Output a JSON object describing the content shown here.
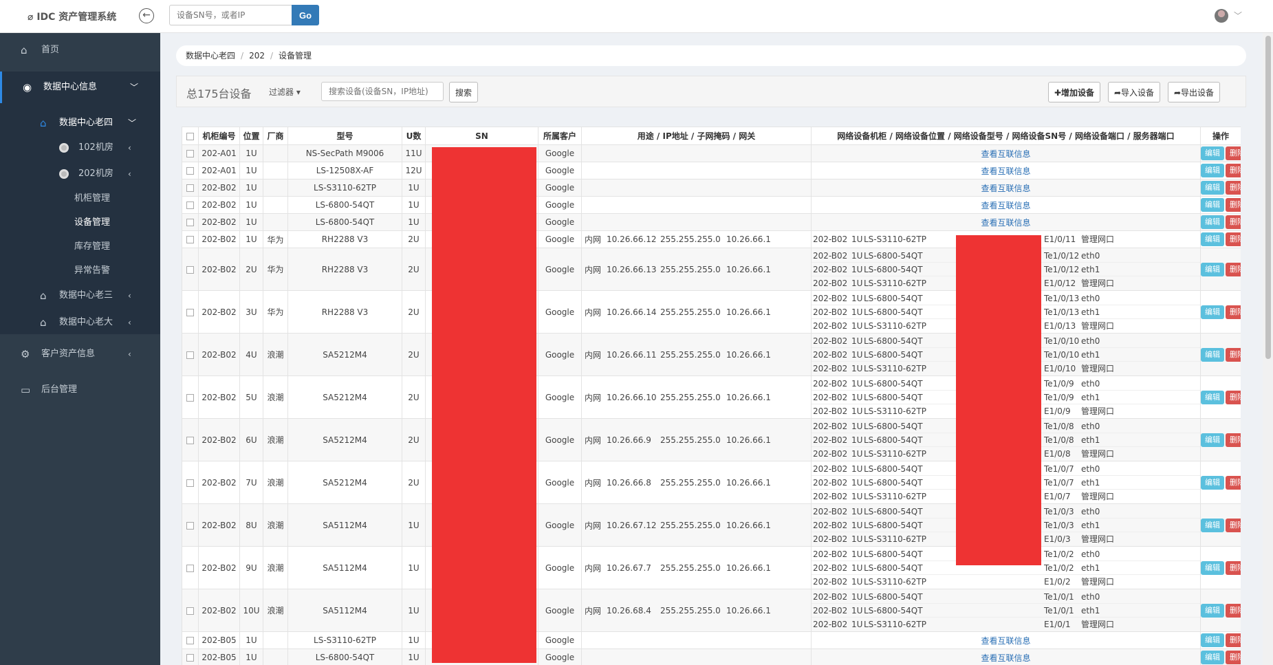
{
  "header": {
    "app_name": "IDC 资产管理系统",
    "logo_glyph": "⌀",
    "search_placeholder": "设备SN号，或者IP",
    "go_label": "Go"
  },
  "sidebar": {
    "home": "首页",
    "dc_info": "数据中心信息",
    "dc_old4": "数据中心老四",
    "room102": "102机房",
    "room202": "202机房",
    "cabinet_mgmt": "机柜管理",
    "device_mgmt": "设备管理",
    "stock_mgmt": "库存管理",
    "alarm": "异常告警",
    "dc_old3": "数据中心老三",
    "dc_big": "数据中心老大",
    "customer_assets": "客户资产信息",
    "backend": "后台管理"
  },
  "breadcrumb": [
    "数据中心老四",
    "202",
    "设备管理"
  ],
  "toolbar": {
    "total": "总175台设备",
    "filter": "过滤器",
    "search_placeholder": "搜索设备(设备SN，IP地址)",
    "search_btn": "搜索",
    "add_btn": "✚增加设备",
    "import_btn": "➦导入设备",
    "export_btn": "➦导出设备"
  },
  "table": {
    "headers": {
      "cabinet": "机柜编号",
      "pos": "位置",
      "vendor": "厂商",
      "model": "型号",
      "u": "U数",
      "sn": "SN",
      "customer": "所属客户",
      "ipinfo": "用途 / IP地址 / 子网掩码 / 网关",
      "netinfo": "网络设备机柜 / 网络设备位置 / 网络设备型号 / 网络设备SN号 / 网络设备端口 / 服务器端口",
      "ops": "操作"
    },
    "view_link": "查看互联信息",
    "edit_label": "编辑",
    "delete_label": "删除",
    "rows": [
      {
        "cab": "202-A01",
        "pos": "1U",
        "vendor": "",
        "model": "NS-SecPath M9006",
        "u": "11U",
        "cust": "Google",
        "type": "link"
      },
      {
        "cab": "202-A01",
        "pos": "1U",
        "vendor": "",
        "model": "LS-12508X-AF",
        "u": "12U",
        "cust": "Google",
        "type": "link"
      },
      {
        "cab": "202-B02",
        "pos": "1U",
        "vendor": "",
        "model": "LS-S3110-62TP",
        "u": "1U",
        "cust": "Google",
        "type": "link"
      },
      {
        "cab": "202-B02",
        "pos": "1U",
        "vendor": "",
        "model": "LS-6800-54QT",
        "u": "1U",
        "cust": "Google",
        "type": "link"
      },
      {
        "cab": "202-B02",
        "pos": "1U",
        "vendor": "",
        "model": "LS-6800-54QT",
        "u": "1U",
        "cust": "Google",
        "type": "link"
      },
      {
        "cab": "202-B02",
        "pos": "1U",
        "vendor": "华为",
        "model": "RH2288 V3",
        "u": "2U",
        "cust": "Google",
        "type": "net",
        "use": "内网",
        "ip": "10.26.66.12",
        "mask": "255.255.255.0",
        "gw": "10.26.66.1",
        "net": [
          {
            "cab": "202-B02",
            "pos": "1U",
            "model": "LS-S3110-62TP",
            "port": "E1/0/11",
            "sport": "管理网口"
          }
        ]
      },
      {
        "cab": "202-B02",
        "pos": "2U",
        "vendor": "华为",
        "model": "RH2288 V3",
        "u": "2U",
        "cust": "Google",
        "type": "net",
        "use": "内网",
        "ip": "10.26.66.13",
        "mask": "255.255.255.0",
        "gw": "10.26.66.1",
        "net": [
          {
            "cab": "202-B02",
            "pos": "1U",
            "model": "LS-6800-54QT",
            "port": "Te1/0/12",
            "sport": "eth0"
          },
          {
            "cab": "202-B02",
            "pos": "1U",
            "model": "LS-6800-54QT",
            "port": "Te1/0/12",
            "sport": "eth1"
          },
          {
            "cab": "202-B02",
            "pos": "1U",
            "model": "LS-S3110-62TP",
            "port": "E1/0/12",
            "sport": "管理网口"
          }
        ]
      },
      {
        "cab": "202-B02",
        "pos": "3U",
        "vendor": "华为",
        "model": "RH2288 V3",
        "u": "2U",
        "cust": "Google",
        "type": "net",
        "use": "内网",
        "ip": "10.26.66.14",
        "mask": "255.255.255.0",
        "gw": "10.26.66.1",
        "net": [
          {
            "cab": "202-B02",
            "pos": "1U",
            "model": "LS-6800-54QT",
            "port": "Te1/0/13",
            "sport": "eth0"
          },
          {
            "cab": "202-B02",
            "pos": "1U",
            "model": "LS-6800-54QT",
            "port": "Te1/0/13",
            "sport": "eth1"
          },
          {
            "cab": "202-B02",
            "pos": "1U",
            "model": "LS-S3110-62TP",
            "port": "E1/0/13",
            "sport": "管理网口"
          }
        ]
      },
      {
        "cab": "202-B02",
        "pos": "4U",
        "vendor": "浪潮",
        "model": "SA5212M4",
        "u": "2U",
        "cust": "Google",
        "type": "net",
        "use": "内网",
        "ip": "10.26.66.11",
        "mask": "255.255.255.0",
        "gw": "10.26.66.1",
        "net": [
          {
            "cab": "202-B02",
            "pos": "1U",
            "model": "LS-6800-54QT",
            "port": "Te1/0/10",
            "sport": "eth0"
          },
          {
            "cab": "202-B02",
            "pos": "1U",
            "model": "LS-6800-54QT",
            "port": "Te1/0/10",
            "sport": "eth1"
          },
          {
            "cab": "202-B02",
            "pos": "1U",
            "model": "LS-S3110-62TP",
            "port": "E1/0/10",
            "sport": "管理网口"
          }
        ]
      },
      {
        "cab": "202-B02",
        "pos": "5U",
        "vendor": "浪潮",
        "model": "SA5212M4",
        "u": "2U",
        "cust": "Google",
        "type": "net",
        "use": "内网",
        "ip": "10.26.66.10",
        "mask": "255.255.255.0",
        "gw": "10.26.66.1",
        "net": [
          {
            "cab": "202-B02",
            "pos": "1U",
            "model": "LS-6800-54QT",
            "port": "Te1/0/9",
            "sport": "eth0"
          },
          {
            "cab": "202-B02",
            "pos": "1U",
            "model": "LS-6800-54QT",
            "port": "Te1/0/9",
            "sport": "eth1"
          },
          {
            "cab": "202-B02",
            "pos": "1U",
            "model": "LS-S3110-62TP",
            "port": "E1/0/9",
            "sport": "管理网口"
          }
        ]
      },
      {
        "cab": "202-B02",
        "pos": "6U",
        "vendor": "浪潮",
        "model": "SA5212M4",
        "u": "2U",
        "cust": "Google",
        "type": "net",
        "use": "内网",
        "ip": "10.26.66.9",
        "mask": "255.255.255.0",
        "gw": "10.26.66.1",
        "net": [
          {
            "cab": "202-B02",
            "pos": "1U",
            "model": "LS-6800-54QT",
            "port": "Te1/0/8",
            "sport": "eth0"
          },
          {
            "cab": "202-B02",
            "pos": "1U",
            "model": "LS-6800-54QT",
            "port": "Te1/0/8",
            "sport": "eth1"
          },
          {
            "cab": "202-B02",
            "pos": "1U",
            "model": "LS-S3110-62TP",
            "port": "E1/0/8",
            "sport": "管理网口"
          }
        ]
      },
      {
        "cab": "202-B02",
        "pos": "7U",
        "vendor": "浪潮",
        "model": "SA5212M4",
        "u": "2U",
        "cust": "Google",
        "type": "net",
        "use": "内网",
        "ip": "10.26.66.8",
        "mask": "255.255.255.0",
        "gw": "10.26.66.1",
        "net": [
          {
            "cab": "202-B02",
            "pos": "1U",
            "model": "LS-6800-54QT",
            "port": "Te1/0/7",
            "sport": "eth0"
          },
          {
            "cab": "202-B02",
            "pos": "1U",
            "model": "LS-6800-54QT",
            "port": "Te1/0/7",
            "sport": "eth1"
          },
          {
            "cab": "202-B02",
            "pos": "1U",
            "model": "LS-S3110-62TP",
            "port": "E1/0/7",
            "sport": "管理网口"
          }
        ]
      },
      {
        "cab": "202-B02",
        "pos": "8U",
        "vendor": "浪潮",
        "model": "SA5112M4",
        "u": "1U",
        "cust": "Google",
        "type": "net",
        "use": "内网",
        "ip": "10.26.67.12",
        "mask": "255.255.255.0",
        "gw": "10.26.66.1",
        "net": [
          {
            "cab": "202-B02",
            "pos": "1U",
            "model": "LS-6800-54QT",
            "port": "Te1/0/3",
            "sport": "eth0"
          },
          {
            "cab": "202-B02",
            "pos": "1U",
            "model": "LS-6800-54QT",
            "port": "Te1/0/3",
            "sport": "eth1"
          },
          {
            "cab": "202-B02",
            "pos": "1U",
            "model": "LS-S3110-62TP",
            "port": "E1/0/3",
            "sport": "管理网口"
          }
        ]
      },
      {
        "cab": "202-B02",
        "pos": "9U",
        "vendor": "浪潮",
        "model": "SA5112M4",
        "u": "1U",
        "cust": "Google",
        "type": "net",
        "use": "内网",
        "ip": "10.26.67.7",
        "mask": "255.255.255.0",
        "gw": "10.26.66.1",
        "net": [
          {
            "cab": "202-B02",
            "pos": "1U",
            "model": "LS-6800-54QT",
            "port": "Te1/0/2",
            "sport": "eth0"
          },
          {
            "cab": "202-B02",
            "pos": "1U",
            "model": "LS-6800-54QT",
            "port": "Te1/0/2",
            "sport": "eth1"
          },
          {
            "cab": "202-B02",
            "pos": "1U",
            "model": "LS-S3110-62TP",
            "port": "E1/0/2",
            "sport": "管理网口"
          }
        ]
      },
      {
        "cab": "202-B02",
        "pos": "10U",
        "vendor": "浪潮",
        "model": "SA5112M4",
        "u": "1U",
        "cust": "Google",
        "type": "net",
        "use": "内网",
        "ip": "10.26.68.4",
        "mask": "255.255.255.0",
        "gw": "10.26.66.1",
        "net": [
          {
            "cab": "202-B02",
            "pos": "1U",
            "model": "LS-6800-54QT",
            "port": "Te1/0/1",
            "sport": "eth0"
          },
          {
            "cab": "202-B02",
            "pos": "1U",
            "model": "LS-6800-54QT",
            "port": "Te1/0/1",
            "sport": "eth1"
          },
          {
            "cab": "202-B02",
            "pos": "1U",
            "model": "LS-S3110-62TP",
            "port": "E1/0/1",
            "sport": "管理网口"
          }
        ]
      },
      {
        "cab": "202-B05",
        "pos": "1U",
        "vendor": "",
        "model": "LS-S3110-62TP",
        "u": "1U",
        "cust": "Google",
        "type": "link"
      },
      {
        "cab": "202-B05",
        "pos": "1U",
        "vendor": "",
        "model": "LS-6800-54QT",
        "u": "1U",
        "cust": "Google",
        "type": "link"
      }
    ]
  },
  "colors": {
    "accent": "#337ab7",
    "sidebar_bg": "#2f3d4a",
    "edit": "#5bc0de",
    "delete": "#d9534f",
    "redaction": "#ee3333"
  }
}
